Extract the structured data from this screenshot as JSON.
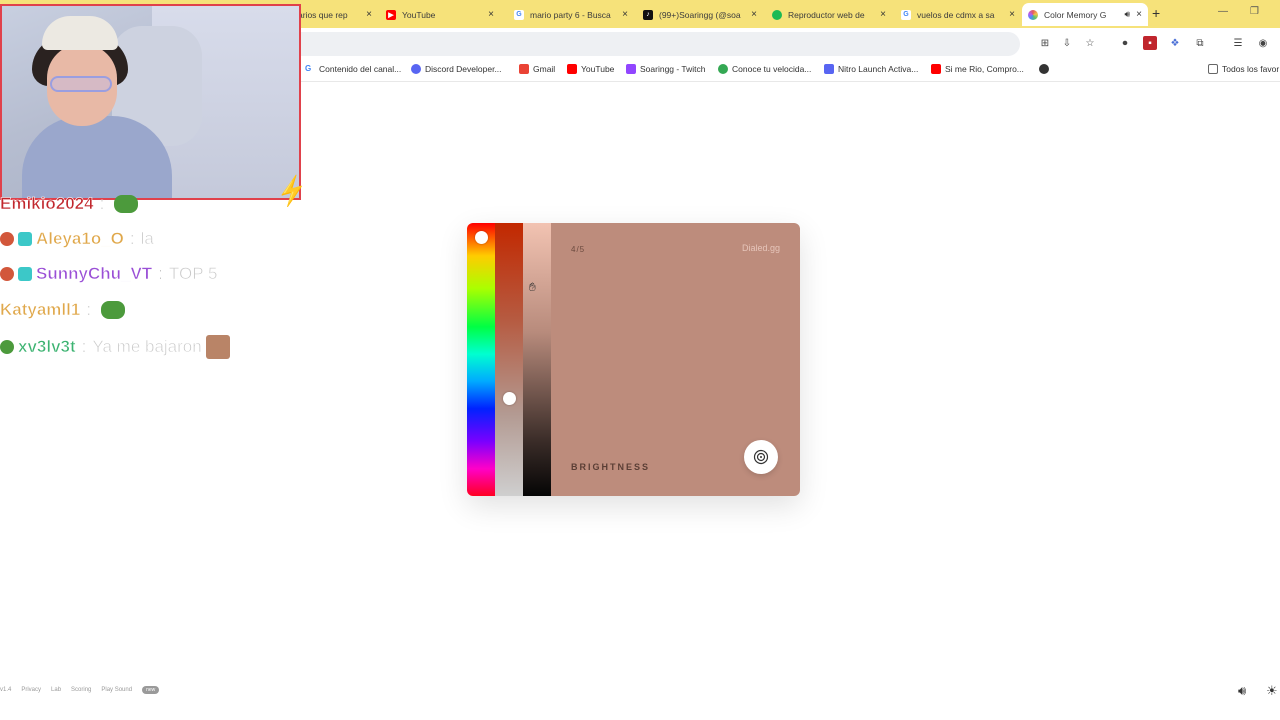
{
  "browser": {
    "tabs": [
      {
        "title": "arios que rep",
        "favicon_color": "#e0e0e0"
      },
      {
        "title": "YouTube",
        "favicon_color": "#ff0000"
      },
      {
        "title": "mario party 6 - Busca",
        "favicon_color": "#4285f4"
      },
      {
        "title": "(99+)Soaringg (@soa",
        "favicon_color": "#111111"
      },
      {
        "title": "Reproductor web de",
        "favicon_color": "#1db954"
      },
      {
        "title": "vuelos de cdmx a sa",
        "favicon_color": "#4285f4"
      },
      {
        "title": "Color Memory G",
        "favicon_color": "#e25c5c",
        "active": true
      }
    ],
    "close_glyph": "×",
    "new_tab_glyph": "+",
    "bookmarks": [
      {
        "label": "Contenido del canal...",
        "icon_color": "#4285f4"
      },
      {
        "label": "Discord Developer...",
        "icon_color": "#5865f2"
      },
      {
        "label": "Gmail",
        "icon_color": "#ea4335"
      },
      {
        "label": "YouTube",
        "icon_color": "#ff0000"
      },
      {
        "label": "Soaringg - Twitch",
        "icon_color": "#9146ff"
      },
      {
        "label": "Conoce tu velocida...",
        "icon_color": "#34a853"
      },
      {
        "label": "Nitro Launch Activa...",
        "icon_color": "#5865f2"
      },
      {
        "label": "Si me Rio, Compro...",
        "icon_color": "#ff0000"
      },
      {
        "label": "Todos los favor",
        "icon_color": "#888888"
      }
    ]
  },
  "chat": {
    "messages": [
      {
        "user": "Emikio2024",
        "user_color": "#c1272d",
        "text": "",
        "emote": "pepe"
      },
      {
        "user": "Aleya1o_O",
        "user_color": "#e0a84b",
        "text": "la",
        "emote": ""
      },
      {
        "user": "SunnyChu_VT",
        "user_color": "#9a4fd6",
        "text": "TOP 5",
        "emote": ""
      },
      {
        "user": "Katyamll1",
        "user_color": "#e0a84b",
        "text": "",
        "emote": "pepe"
      },
      {
        "user": "xv3lv3t",
        "user_color": "#3cb371",
        "text": "Ya me bajaron",
        "emote": "face"
      }
    ],
    "separator": ":"
  },
  "game": {
    "round": "4/5",
    "brand": "Dialed.gg",
    "parameter": "BRIGHTNESS",
    "target_color": "#bd8c7c",
    "hue_position": 0.03,
    "saturation_position": 0.65,
    "brightness_position": 0.24
  },
  "footer": {
    "version": "v1.4",
    "links": [
      "Privacy",
      "Lab",
      "Scoring",
      "Play Sound"
    ],
    "pill": "new"
  }
}
